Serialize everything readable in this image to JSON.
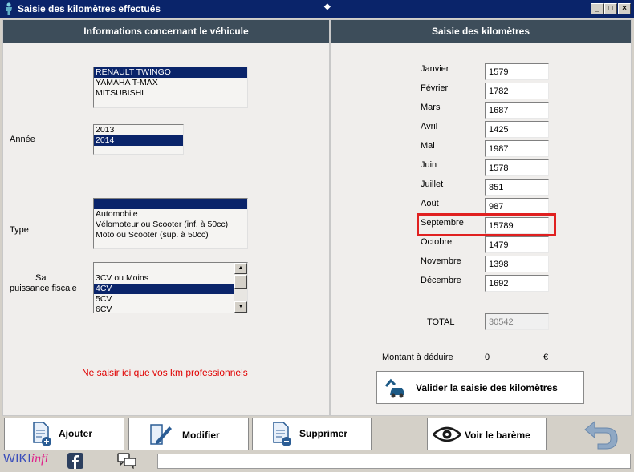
{
  "window": {
    "title": "Saisie des kilomètres effectués"
  },
  "left_panel": {
    "header": "Informations concernant le véhicule",
    "vehicles": [
      "RENAULT TWINGO",
      "YAMAHA T-MAX",
      "MITSUBISHI"
    ],
    "vehicle_selected_index": 0,
    "year_label": "Année",
    "years": [
      "2013",
      "2014"
    ],
    "year_selected_index": 1,
    "type_label": "Type",
    "types": [
      "",
      "Automobile",
      "Vélomoteur ou Scooter (inf. à 50cc)",
      "Moto ou Scooter  (sup. à 50cc)"
    ],
    "type_selected_index": 0,
    "power_label_1": "Sa",
    "power_label_2": "puissance fiscale",
    "powers": [
      "3CV ou Moins",
      "4CV",
      "5CV",
      "6CV"
    ],
    "power_selected_index": 1,
    "warning": "Ne saisir ici que vos km professionnels"
  },
  "right_panel": {
    "header": "Saisie des kilomètres",
    "months": [
      {
        "label": "Janvier",
        "value": "1579"
      },
      {
        "label": "Février",
        "value": "1782"
      },
      {
        "label": "Mars",
        "value": "1687"
      },
      {
        "label": "Avril",
        "value": "1425"
      },
      {
        "label": "Mai",
        "value": "1987"
      },
      {
        "label": "Juin",
        "value": "1578"
      },
      {
        "label": "Juillet",
        "value": "851"
      },
      {
        "label": "Août",
        "value": "987"
      },
      {
        "label": "Septembre",
        "value": "15789"
      },
      {
        "label": "Octobre",
        "value": "1479"
      },
      {
        "label": "Novembre",
        "value": "1398"
      },
      {
        "label": "Décembre",
        "value": "1692"
      }
    ],
    "total_label": "TOTAL",
    "total_value": "30542",
    "deduct_label": "Montant à déduire",
    "deduct_value": "0",
    "currency": "€",
    "validate_label": "Valider la saisie des kilomètres"
  },
  "toolbar": {
    "add_label": "Ajouter",
    "edit_label": "Modifier",
    "delete_label": "Supprimer",
    "scale_label": "Voir le barème"
  },
  "footer": {
    "logo_part1": "WIKI",
    "logo_part2": "infi"
  },
  "colors": {
    "title_bar": "#0a246a",
    "panel_header": "#3d4d5a",
    "selection": "#0a246a",
    "warning": "#e00000",
    "highlight": "#e02020"
  }
}
